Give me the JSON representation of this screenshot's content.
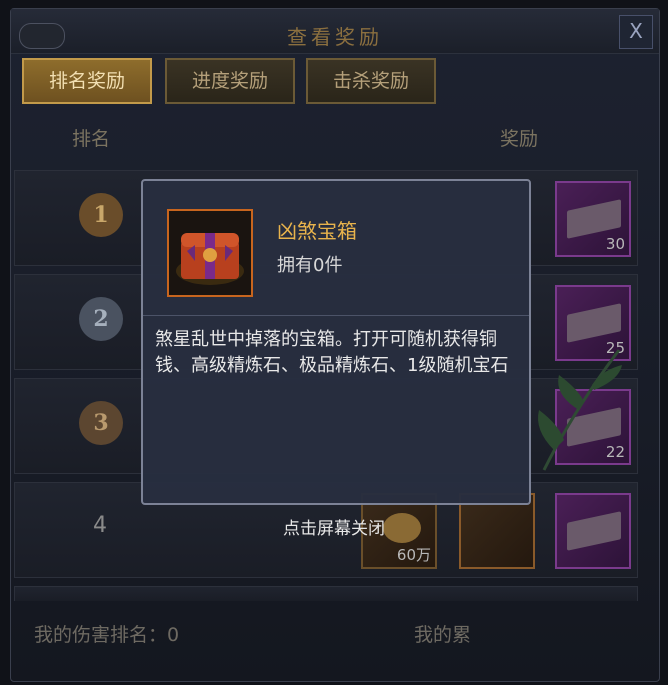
{
  "window": {
    "title": "查看奖励",
    "close_label": "X"
  },
  "tabs": [
    {
      "label": "排名奖励",
      "active": true
    },
    {
      "label": "进度奖励",
      "active": false
    },
    {
      "label": "击杀奖励",
      "active": false
    }
  ],
  "table_headers": {
    "rank": "排名",
    "reward": "奖励"
  },
  "rows": [
    {
      "rank": "1",
      "counts": [
        "30"
      ]
    },
    {
      "rank": "2",
      "counts": [
        "25"
      ]
    },
    {
      "rank": "3",
      "counts": [
        "22"
      ]
    },
    {
      "rank": "4",
      "counts": [
        "60万"
      ]
    }
  ],
  "footer": {
    "my_rank": "我的伤害排名：0",
    "my_total": "我的累"
  },
  "tooltip": {
    "name": "凶煞宝箱",
    "owned": "拥有0件",
    "description": "煞星乱世中掉落的宝箱。打开可随机获得铜钱、高级精炼石、极品精炼石、1级随机宝石",
    "close_hint": "点击屏幕关闭"
  },
  "colors": {
    "accent": "#e8b34c",
    "tab_active": "#8e6d2c",
    "rarity_purple": "#7a3a8c"
  }
}
